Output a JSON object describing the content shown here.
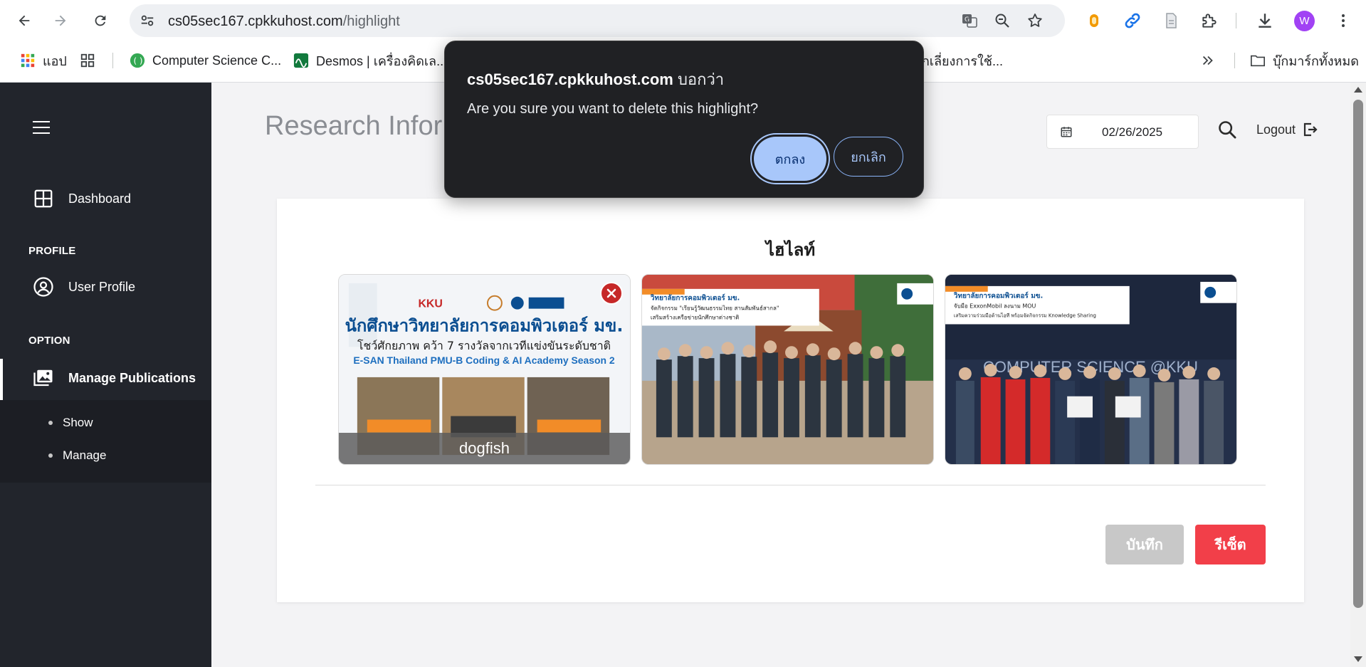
{
  "browser": {
    "url_host": "cs05sec167.cpkkuhost.com",
    "url_path": "/highlight",
    "profile_initial": "W",
    "bookmarks": [
      {
        "label": "แอป",
        "icon": "apps-grid-icon"
      },
      {
        "label": "",
        "icon": "tab-groups-icon"
      },
      {
        "label": "Computer Science C...",
        "icon": "cs-site-icon"
      },
      {
        "label": "Desmos | เครื่องคิดเล...",
        "icon": "desmos-icon"
      },
      {
        "label": ":: หลีกเลี่ยงการใช้...",
        "icon": ""
      }
    ],
    "all_bookmarks_label": "บุ๊กมาร์กทั้งหมด"
  },
  "sidebar": {
    "dashboard": "Dashboard",
    "profile_heading": "PROFILE",
    "user_profile": "User Profile",
    "option_heading": "OPTION",
    "manage_publications": "Manage Publications",
    "sub_show": "Show",
    "sub_manage": "Manage"
  },
  "header": {
    "title": "Research Infor",
    "date": "02/26/2025",
    "logout": "Logout"
  },
  "card": {
    "title": "ไฮไลท์",
    "highlights": [
      {
        "caption": "dogfish",
        "has_delete": true
      },
      {
        "caption": "",
        "has_delete": false
      },
      {
        "caption": "",
        "has_delete": false
      }
    ],
    "thumb1_text": {
      "line1": "นักศึกษาวิทยาลัยการคอมพิวเตอร์ มข.",
      "line2": "โชว์ศักยภาพ คว้า 7 รางวัลจากเวทีแข่งขันระดับชาติ",
      "line3": "E-SAN Thailand PMU-B Coding & AI Academy Season 2",
      "logo": "KKU"
    },
    "thumb2_text": {
      "line1": "วิทยาลัยการคอมพิวเตอร์ มข.",
      "line2": "จัดกิจกรรม \"เรียนรู้วัฒนธรรมไทย สานสัมพันธ์สากล\"",
      "line3": "เสริมสร้างเครือข่ายนักศึกษาต่างชาติ"
    },
    "thumb3_text": {
      "line1": "วิทยาลัยการคอมพิวเตอร์ มข.",
      "line2": "จับมือ ExxonMobil ลงนาม MOU",
      "line3": "เสริมความร่วมมือด้านไอที พร้อมจัดกิจกรรม Knowledge Sharing",
      "wall": "COMPUTER SCIENCE @KKU"
    },
    "save_label": "บันทึก",
    "reset_label": "รีเซ็ต"
  },
  "dialog": {
    "host": "cs05sec167.cpkkuhost.com",
    "says": " บอกว่า",
    "message": "Are you sure you want to delete this highlight?",
    "ok": "ตกลง",
    "cancel": "ยกเลิก"
  },
  "colors": {
    "sidebar_bg": "#22252c",
    "reset_red": "#f23f49",
    "save_gray": "#c8c8c8",
    "dialog_bg": "#202124",
    "dialog_ok": "#a8c7fa"
  }
}
